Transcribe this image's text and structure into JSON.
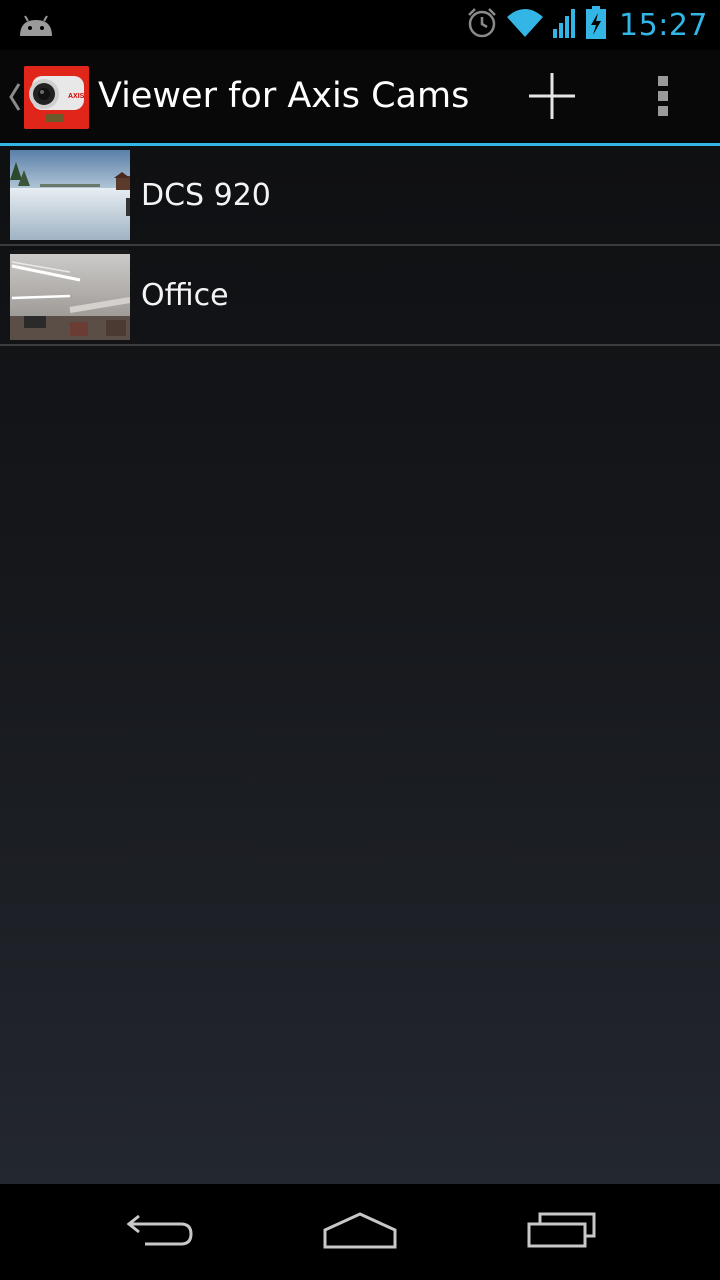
{
  "status_bar": {
    "time": "15:27",
    "accent_color": "#33b5e5",
    "icons": [
      "android-debug-icon",
      "alarm-icon",
      "wifi-icon",
      "signal-icon",
      "battery-charging-icon"
    ]
  },
  "action_bar": {
    "title": "Viewer for Axis Cams",
    "icons": [
      "up-caret-icon",
      "axis-camera-app-icon",
      "add-icon",
      "overflow-menu-icon"
    ],
    "logo_text": "AXIS"
  },
  "cameras": [
    {
      "name": "DCS 920",
      "thumbnail": "snowy-field-thumbnail"
    },
    {
      "name": "Office",
      "thumbnail": "office-ceiling-thumbnail"
    }
  ],
  "nav_bar": {
    "icons": [
      "back-icon",
      "home-icon",
      "recent-apps-icon"
    ]
  }
}
